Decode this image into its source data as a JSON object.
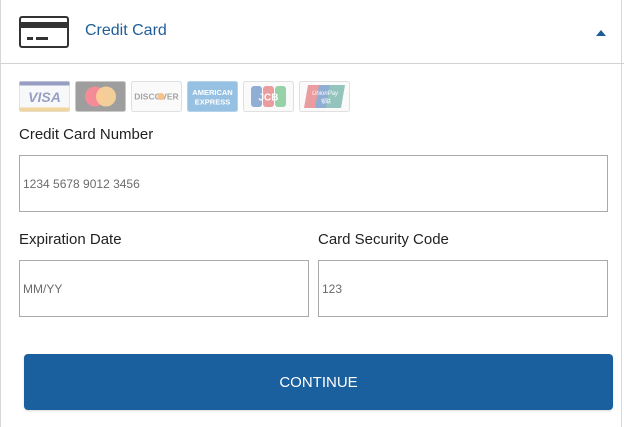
{
  "header": {
    "title": "Credit Card",
    "icon": "credit-card-icon",
    "toggle_icon": "triangle-up-icon",
    "accent": "#1f5d98"
  },
  "card_brands": [
    "VISA",
    "Mastercard",
    "DISCOVER",
    "AMERICAN EXPRESS",
    "JCB",
    "UnionPay"
  ],
  "form": {
    "card_number": {
      "label": "Credit Card Number",
      "placeholder": "1234 5678 9012 3456",
      "value": ""
    },
    "expiration": {
      "label": "Expiration Date",
      "placeholder": "MM/YY",
      "value": ""
    },
    "security_code": {
      "label": "Card Security Code",
      "placeholder": "123",
      "value": ""
    }
  },
  "continue_button": {
    "label": "CONTINUE",
    "color": "#1a5f9e"
  }
}
